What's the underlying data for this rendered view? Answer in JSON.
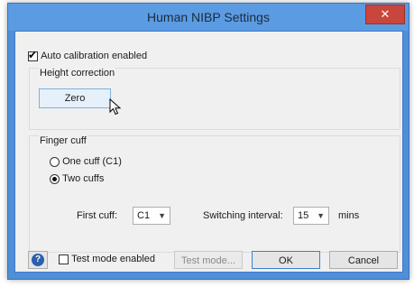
{
  "window": {
    "title": "Human NIBP Settings",
    "close_glyph": "✕"
  },
  "auto_calibration": {
    "label": "Auto calibration enabled",
    "checked": true
  },
  "height_correction": {
    "title": "Height correction",
    "zero_label": "Zero"
  },
  "finger_cuff": {
    "title": "Finger cuff",
    "options": [
      {
        "label": "One cuff (C1)",
        "selected": false
      },
      {
        "label": "Two cuffs",
        "selected": true
      }
    ],
    "first_cuff_label": "First cuff:",
    "first_cuff_value": "C1",
    "switching_label": "Switching interval:",
    "switching_value": "15",
    "switching_unit": "mins"
  },
  "footer": {
    "help_glyph": "?",
    "test_mode_label": "Test mode enabled",
    "test_mode_checked": false,
    "test_mode_button": "Test mode...",
    "ok_label": "OK",
    "cancel_label": "Cancel"
  },
  "icons": {
    "dropdown": "chevron-down-icon",
    "help": "help-icon",
    "close": "close-icon"
  }
}
